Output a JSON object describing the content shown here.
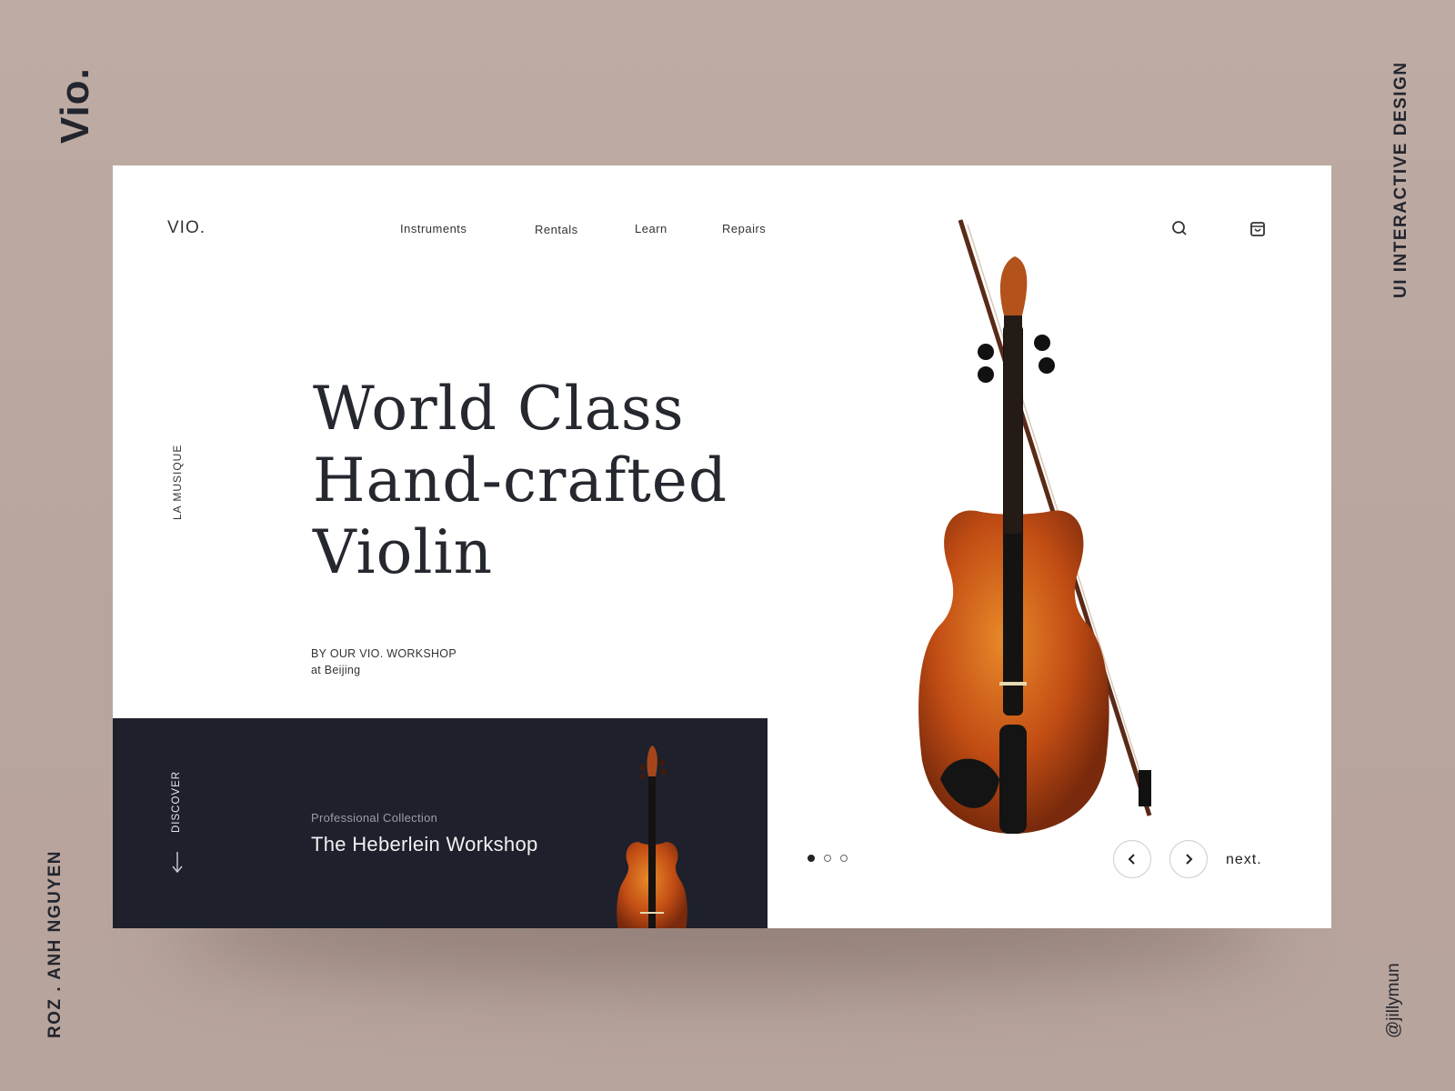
{
  "frame": {
    "brand": "Vio.",
    "tagline": "UI  INTERACTIVE DESIGN",
    "author": "ROZ . ANH  NGUYEN",
    "handle": "@jillymun",
    "background": "#bdaba3"
  },
  "header": {
    "logo": "VIO.",
    "nav": [
      "Instruments",
      "Rentals",
      "Learn",
      "Repairs"
    ],
    "icons": [
      "search-icon",
      "shopping-bag-icon"
    ]
  },
  "hero": {
    "side_label": "LA MUSIQUE",
    "title_lines": [
      "World Class",
      "Hand-crafted",
      "Violin"
    ],
    "byline": "BY OUR VIO. WORKSHOP",
    "location": "at Beijing"
  },
  "discover": {
    "label": "DISCOVER",
    "subtitle": "Professional Collection",
    "title": "The Heberlein Workshop",
    "background": "#1e202b"
  },
  "carousel": {
    "slides": 3,
    "active": 1,
    "next_label": "next."
  }
}
